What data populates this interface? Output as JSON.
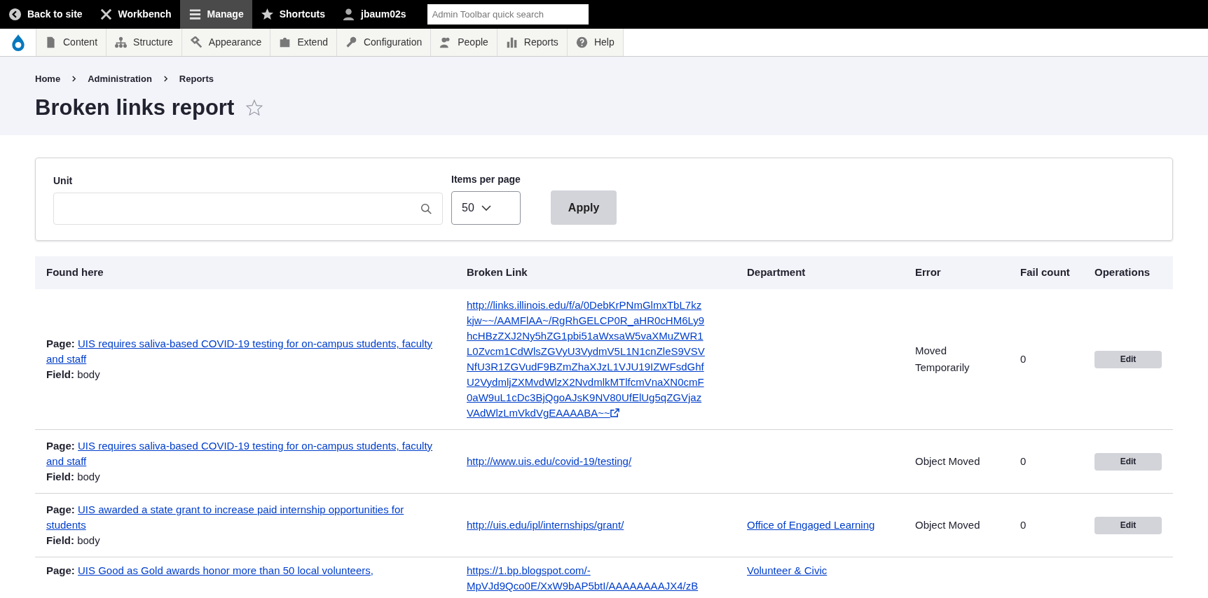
{
  "toolbar": {
    "items": [
      {
        "label": "Back to site",
        "selected": false
      },
      {
        "label": "Workbench",
        "selected": false
      },
      {
        "label": "Manage",
        "selected": true
      },
      {
        "label": "Shortcuts",
        "selected": false
      },
      {
        "label": "jbaum02s",
        "selected": false
      }
    ],
    "search": {
      "placeholder": "Admin Toolbar quick search"
    }
  },
  "menu": [
    {
      "label": "Content"
    },
    {
      "label": "Structure"
    },
    {
      "label": "Appearance"
    },
    {
      "label": "Extend"
    },
    {
      "label": "Configuration"
    },
    {
      "label": "People"
    },
    {
      "label": "Reports"
    },
    {
      "label": "Help"
    }
  ],
  "breadcrumb": [
    "Home",
    "Administration",
    "Reports"
  ],
  "title": "Broken links report",
  "filters": {
    "unit": {
      "label": "Unit"
    },
    "items_per_page": {
      "label": "Items per page",
      "value": "50"
    },
    "apply": "Apply"
  },
  "table": {
    "columns": [
      "Found here",
      "Broken Link",
      "Department",
      "Error",
      "Fail count",
      "Operations"
    ],
    "rows": [
      {
        "page_label": "Page:",
        "page_title": "UIS requires saliva-based COVID-19 testing for on-campus students, faculty and staff",
        "field_label": "Field:",
        "field": "body",
        "link": "http://links.illinois.edu/f/a/0DebKrPNmGlmxTbL7kzkjw~~/AAMFlAA~/RgRhGELCP0R_aHR0cHM6Ly9hcHBzZXJ2Ny5hZG1pbi51aWxsaW5vaXMuZWR1L0Zvcm1CdWlsZGVyU3VydmV5L1N1cnZleS9VSVNfU3R1ZGVudF9BZmZhaXJzL1VJU19IZWFsdGhfU2VydmljZXMvdWlzX2NvdmlkMTlfcmVnaXN0cmF0aW9uL1cDc3BjQgoAJsK9NV80UfElUg5qZGVjazVAdWlzLmVkdVgEAAAABA~~",
        "external": true,
        "error": "Moved Temporarily",
        "fail_count": "0",
        "operation": "Edit"
      },
      {
        "page_label": "Page:",
        "page_title": "UIS requires saliva-based COVID-19 testing for on-campus students, faculty and staff",
        "field_label": "Field:",
        "field": "body",
        "link": "http://www.uis.edu/covid-19/testing/",
        "error": "Object Moved",
        "fail_count": "0",
        "operation": "Edit"
      },
      {
        "page_label": "Page:",
        "page_title": "UIS awarded a state grant to increase paid internship opportunities for students",
        "field_label": "Field:",
        "field": "body",
        "link": "http://uis.edu/ipl/internships/grant/",
        "department": "Office of Engaged Learning",
        "error": "Object Moved",
        "fail_count": "0",
        "operation": "Edit"
      },
      {
        "page_label": "Page:",
        "page_title": "UIS Good as Gold awards honor more than 50 local volunteers,",
        "link": "https://1.bp.blogspot.com/-MpVJd9Qco0E/XxW9bAP5btI/AAAAAAAAJX4/zB",
        "department": "Volunteer & Civic"
      }
    ]
  }
}
